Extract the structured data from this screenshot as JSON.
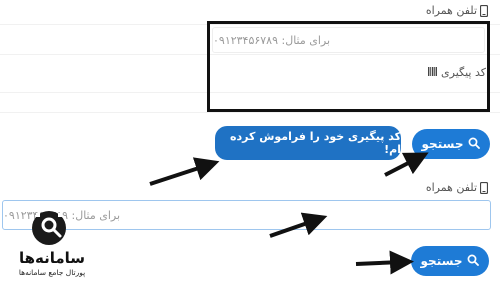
{
  "top_section": {
    "phone_label": "تلفن همراه",
    "phone_placeholder": "برای مثال: ۰۹۱۲۳۴۵۶۷۸۹",
    "tracking_label": "کد پیگیری"
  },
  "buttons": {
    "search_label": "جستجو",
    "forgot_label": "کد پیگیری خود را فراموش کرده ام!"
  },
  "bottom_section": {
    "phone_label": "تلفن همراه",
    "phone_placeholder": "برای مثال: ۰۹۱۲۳۴۵۶۷۸۹",
    "search_label": "جستجو"
  },
  "logo": {
    "brand_name": "سامانه‌ها",
    "tagline": "پورتال جامع سامانه‌ها"
  },
  "colors": {
    "primary_button": "#1e7bd6",
    "forgot_button": "#1f72c4",
    "frame": "#111111"
  }
}
